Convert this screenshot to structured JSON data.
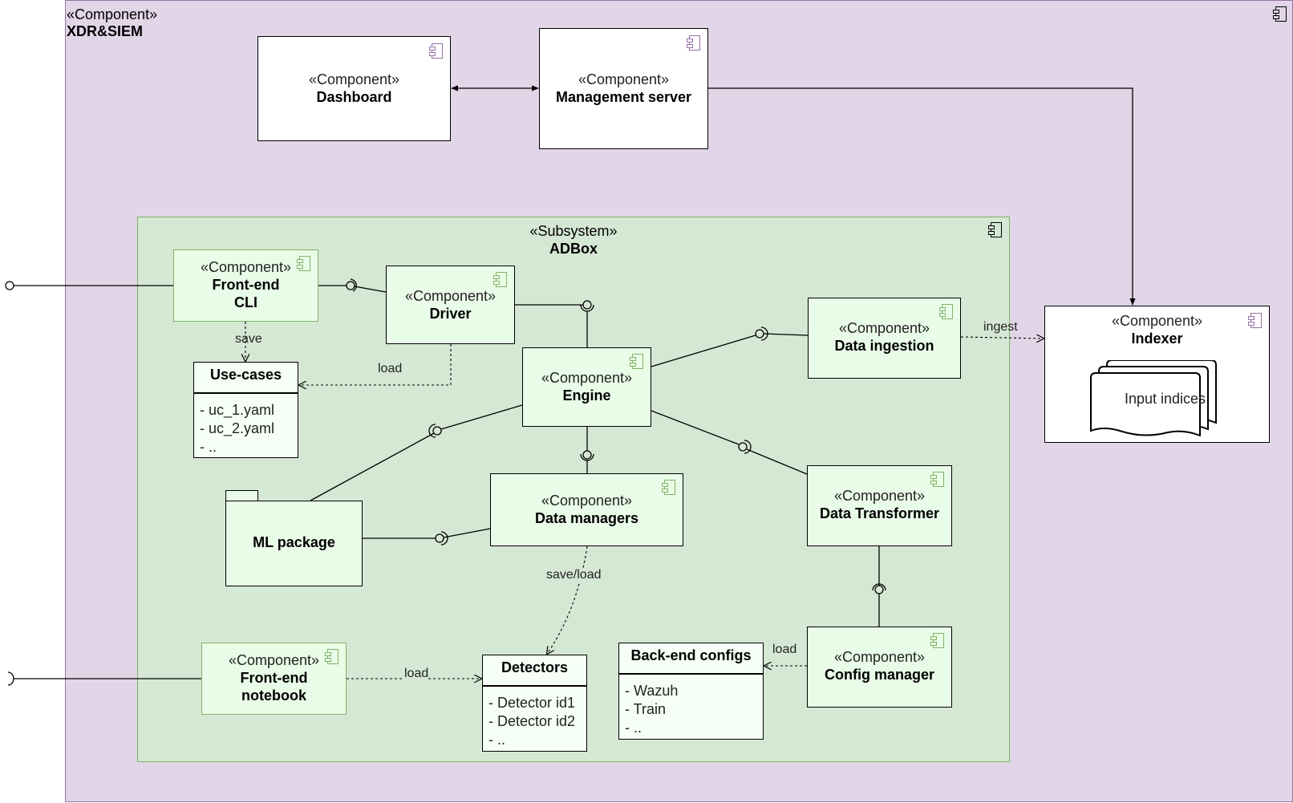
{
  "outer": {
    "stereotype": "«Component»",
    "name": "XDR&SIEM"
  },
  "adbox": {
    "stereotype": "«Subsystem»",
    "name": "ADBox"
  },
  "components": {
    "dashboard": {
      "stereotype": "«Component»",
      "name": "Dashboard"
    },
    "management_server": {
      "stereotype": "«Component»",
      "name": "Management server"
    },
    "indexer": {
      "stereotype": "«Component»",
      "name": "Indexer",
      "inner_doc": "Input indices"
    },
    "frontend_cli": {
      "stereotype": "«Component»",
      "name_line1": "Front-end",
      "name_line2": "CLI"
    },
    "driver": {
      "stereotype": "«Component»",
      "name": "Driver"
    },
    "engine": {
      "stereotype": "«Component»",
      "name": "Engine"
    },
    "data_ingestion": {
      "stereotype": "«Component»",
      "name": "Data ingestion"
    },
    "data_managers": {
      "stereotype": "«Component»",
      "name": "Data managers"
    },
    "data_transformer": {
      "stereotype": "«Component»",
      "name": "Data Transformer"
    },
    "config_manager": {
      "stereotype": "«Component»",
      "name": "Config manager"
    },
    "frontend_notebook": {
      "stereotype": "«Component»",
      "name_line1": "Front-end",
      "name_line2": "notebook"
    },
    "ml_package": {
      "name": "ML package"
    }
  },
  "lists": {
    "use_cases": {
      "title": "Use-cases",
      "items": [
        "- uc_1.yaml",
        "- uc_2.yaml",
        "- .."
      ]
    },
    "detectors": {
      "title": "Detectors",
      "items": [
        "- Detector id1",
        "- Detector id2",
        "- .."
      ]
    },
    "backend_configs": {
      "title": "Back-end configs",
      "items": [
        "- Wazuh",
        "- Train",
        "- .."
      ]
    }
  },
  "edge_labels": {
    "save": "save",
    "load_driver": "load",
    "ingest": "ingest",
    "save_load": "save/load",
    "load_notebook": "load",
    "load_config": "load"
  },
  "colors": {
    "outer_fill": "#e1d5e7",
    "outer_stroke": "#9673a6",
    "subsystem_fill": "#d5e8d4",
    "subsystem_stroke": "#82b366",
    "component_fill": "#e9fce8"
  }
}
